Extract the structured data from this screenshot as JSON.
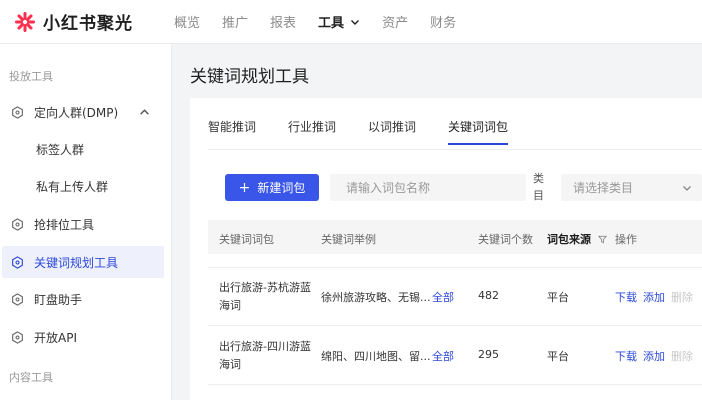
{
  "header": {
    "logo_text": "小红书聚光",
    "nav": [
      "概览",
      "推广",
      "报表",
      "工具",
      "资产",
      "财务"
    ],
    "active_nav": "工具",
    "brand_color": "#ff2e4d"
  },
  "sidebar": {
    "group1": "投放工具",
    "items": [
      {
        "label": "定向人群(DMP)",
        "expanded": true
      },
      {
        "label": "标签人群"
      },
      {
        "label": "私有上传人群"
      },
      {
        "label": "抢排位工具"
      },
      {
        "label": "关键词规划工具",
        "active": true
      },
      {
        "label": "盯盘助手"
      },
      {
        "label": "开放API"
      }
    ],
    "group2": "内容工具"
  },
  "main": {
    "title": "关键词规划工具",
    "tabs": [
      "智能推词",
      "行业推词",
      "以词推词",
      "关键词词包"
    ],
    "active_tab": "关键词词包",
    "new_button": "新建词包",
    "name_placeholder": "请输入词包名称",
    "category_label": "类目",
    "category_placeholder": "请选择类目",
    "accent_color": "#3956e8"
  },
  "table": {
    "columns": [
      "关键词词包",
      "关键词举例",
      "关键词个数",
      "词包来源",
      "操作"
    ],
    "rows": [
      {
        "name": "出行旅游-苏杭游蓝海词",
        "example": "徐州旅游攻略、无锡...",
        "all": "全部",
        "count": "482",
        "source": "平台",
        "ops": [
          "下载",
          "添加",
          "删除"
        ]
      },
      {
        "name": "出行旅游-四川游蓝海词",
        "example": "绵阳、四川地图、留...",
        "all": "全部",
        "count": "295",
        "source": "平台",
        "ops": [
          "下载",
          "添加",
          "删除"
        ]
      }
    ]
  }
}
